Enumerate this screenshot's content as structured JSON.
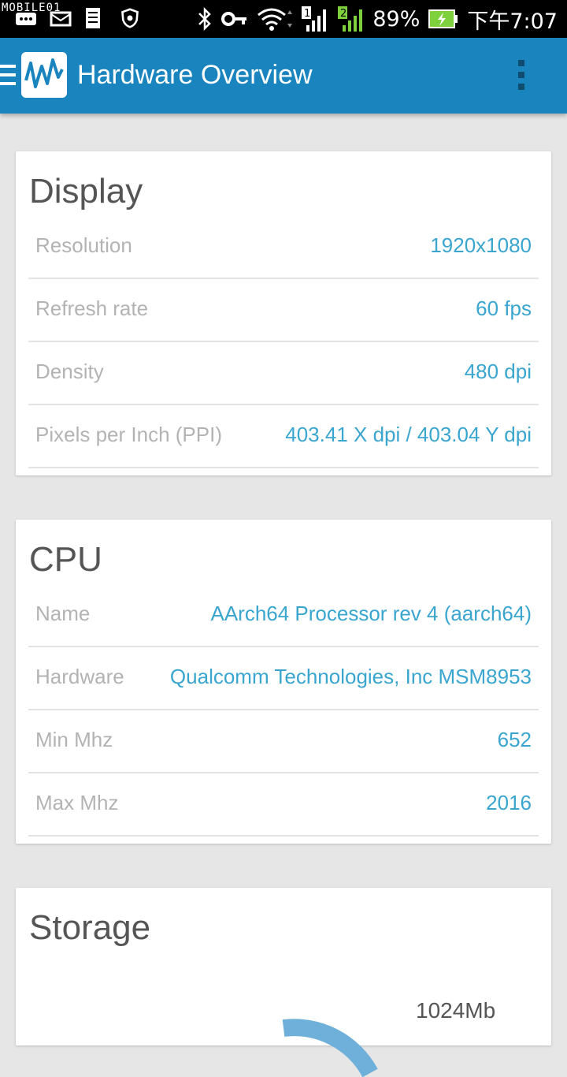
{
  "status_bar": {
    "watermark": "MOBILE01",
    "battery_percent": "89%",
    "time": "下午7:07",
    "sim1": "1",
    "sim2": "2"
  },
  "app_bar": {
    "title": "Hardware Overview",
    "color": "#1a84bf"
  },
  "display": {
    "title": "Display",
    "rows": [
      {
        "label": "Resolution",
        "value": "1920x1080"
      },
      {
        "label": "Refresh rate",
        "value": "60 fps"
      },
      {
        "label": "Density",
        "value": "480 dpi"
      },
      {
        "label": "Pixels per Inch (PPI)",
        "value": "403.41 X dpi / 403.04 Y dpi"
      }
    ]
  },
  "cpu": {
    "title": "CPU",
    "rows": [
      {
        "label": "Name",
        "value": "AArch64 Processor rev 4 (aarch64)"
      },
      {
        "label": "Hardware",
        "value": "Qualcomm Technologies, Inc MSM8953"
      },
      {
        "label": "Min Mhz",
        "value": "652"
      },
      {
        "label": "Max Mhz",
        "value": "2016"
      }
    ]
  },
  "storage": {
    "title": "Storage",
    "partial_label": "1024Mb"
  },
  "colors": {
    "value_text": "#3aa6cf",
    "label_text": "#b3b3b3",
    "donut": "#6fb0db"
  }
}
